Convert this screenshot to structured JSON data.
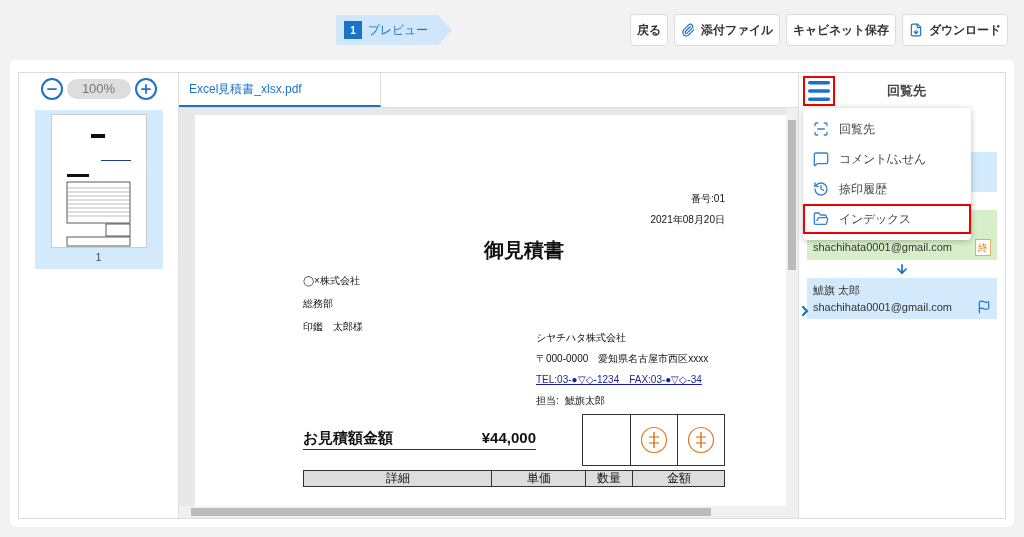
{
  "steps": [
    {
      "number": "1",
      "label": "プレビュー",
      "selected": true
    }
  ],
  "toolbar_buttons": [
    {
      "label": "戻る"
    },
    {
      "label": "添付ファイル"
    },
    {
      "label": "キャビネット保存"
    },
    {
      "label": "ダウンロード"
    }
  ],
  "thumbnails": {
    "zoom": "100%",
    "pages": [
      {
        "label": "1",
        "selected": true
      }
    ]
  },
  "file_tabs": [
    {
      "label": "Excel見積書_xlsx.pdf",
      "selected": true
    }
  ],
  "document": {
    "number": "番号:01",
    "date": "2021年08月20日",
    "title": "御見積書",
    "to_lines": [
      "◯×株式会社",
      "総務部",
      "印鑑　太郎様"
    ],
    "company": "シヤチハタ株式会社",
    "address": "〒000-0000　愛知県名古屋市西区xxxx",
    "contact_link": "TEL:03-●▽◇-1234　FAX:03-●▽◇-34",
    "person_label": "担当:",
    "person": "鯱旗太郎",
    "amount_label": "お見積額金額",
    "amount": "¥44,000",
    "stamp_cells": [
      {
        "kind": "empty"
      },
      {
        "kind": "stamp"
      },
      {
        "kind": "stamp"
      }
    ],
    "table_columns": [
      "詳細",
      "単価",
      "数量",
      "金額"
    ]
  },
  "side_panel": {
    "menu_button_highlighted": true,
    "title": "回覧先",
    "menu": [
      {
        "label": "回覧先",
        "selected": false
      },
      {
        "label": "コメント/ふせん",
        "selected": false
      },
      {
        "label": "捺印履歴",
        "selected": false
      },
      {
        "label": "インデックス",
        "selected": true
      }
    ],
    "recipients": [
      {
        "kind": "pending"
      },
      {
        "kind": "done",
        "email": "shachihata0001@gmail.com",
        "badge": "終"
      },
      {
        "kind": "pending",
        "name": "鯱旗 太郎",
        "email": "shachihata0001@gmail.com",
        "flag": true
      }
    ]
  }
}
